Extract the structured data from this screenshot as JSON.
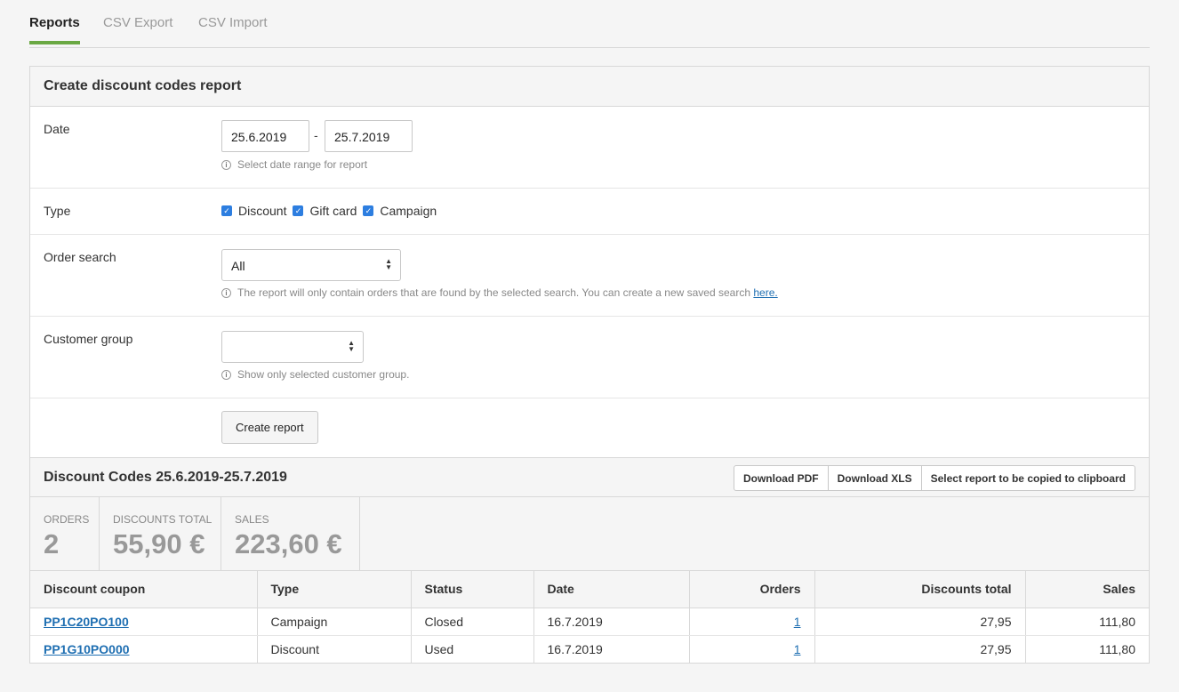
{
  "tabs": [
    {
      "label": "Reports",
      "active": true
    },
    {
      "label": "CSV Export",
      "active": false
    },
    {
      "label": "CSV Import",
      "active": false
    }
  ],
  "form": {
    "title": "Create discount codes report",
    "date": {
      "label": "Date",
      "start": "25.6.2019",
      "separator": "-",
      "end": "25.7.2019",
      "hint": "Select date range for report"
    },
    "type": {
      "label": "Type",
      "options": [
        {
          "label": "Discount",
          "checked": true
        },
        {
          "label": "Gift card",
          "checked": true
        },
        {
          "label": "Campaign",
          "checked": true
        }
      ]
    },
    "order_search": {
      "label": "Order search",
      "selected": "All",
      "hint": "The report will only contain orders that are found by the selected search. You can create a new saved search",
      "hint_link": "here."
    },
    "customer_group": {
      "label": "Customer group",
      "selected": "",
      "hint": "Show only selected customer group."
    },
    "create_button": "Create report"
  },
  "results": {
    "title": "Discount Codes 25.6.2019-25.7.2019",
    "buttons": {
      "pdf": "Download PDF",
      "xls": "Download XLS",
      "clipboard": "Select report to be copied to clipboard"
    },
    "stats": {
      "orders_label": "ORDERS",
      "orders_value": "2",
      "discounts_label": "DISCOUNTS TOTAL",
      "discounts_value": "55,90 €",
      "sales_label": "SALES",
      "sales_value": "223,60 €"
    },
    "table": {
      "headers": [
        "Discount coupon",
        "Type",
        "Status",
        "Date",
        "Orders",
        "Discounts total",
        "Sales"
      ],
      "rows": [
        {
          "coupon": "PP1C20PO100",
          "type": "Campaign",
          "status": "Closed",
          "date": "16.7.2019",
          "orders": "1",
          "discounts": "27,95",
          "sales": "111,80"
        },
        {
          "coupon": "PP1G10PO000",
          "type": "Discount",
          "status": "Used",
          "date": "16.7.2019",
          "orders": "1",
          "discounts": "27,95",
          "sales": "111,80"
        }
      ]
    }
  },
  "colors": {
    "accent": "#6aa843",
    "link": "#1f6fb2",
    "checkbox": "#2d7ee0"
  }
}
